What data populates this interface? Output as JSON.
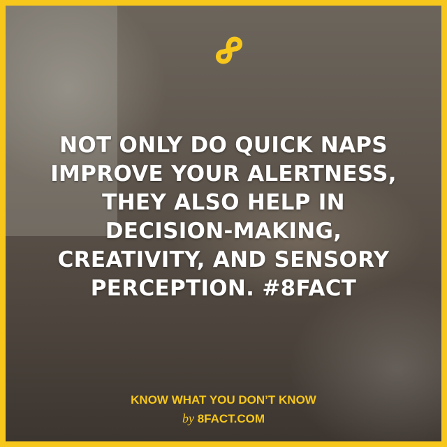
{
  "fact_lines": [
    "NOT ONLY DO QUICK NAPS",
    "IMPROVE YOUR ALERTNESS,",
    "THEY ALSO HELP IN",
    "DECISION-MAKING,",
    "CREATIVITY, AND SENSORY",
    "PERCEPTION. #8FACT"
  ],
  "tagline": "KNOW WHAT YOU DON’T KNOW",
  "by": "by",
  "site": "8FACT.COM",
  "logo": {
    "icon": "infinity-8-logo",
    "text": "8FACT"
  },
  "colors": {
    "accent": "#f7c71c",
    "text": "#ffffff"
  }
}
